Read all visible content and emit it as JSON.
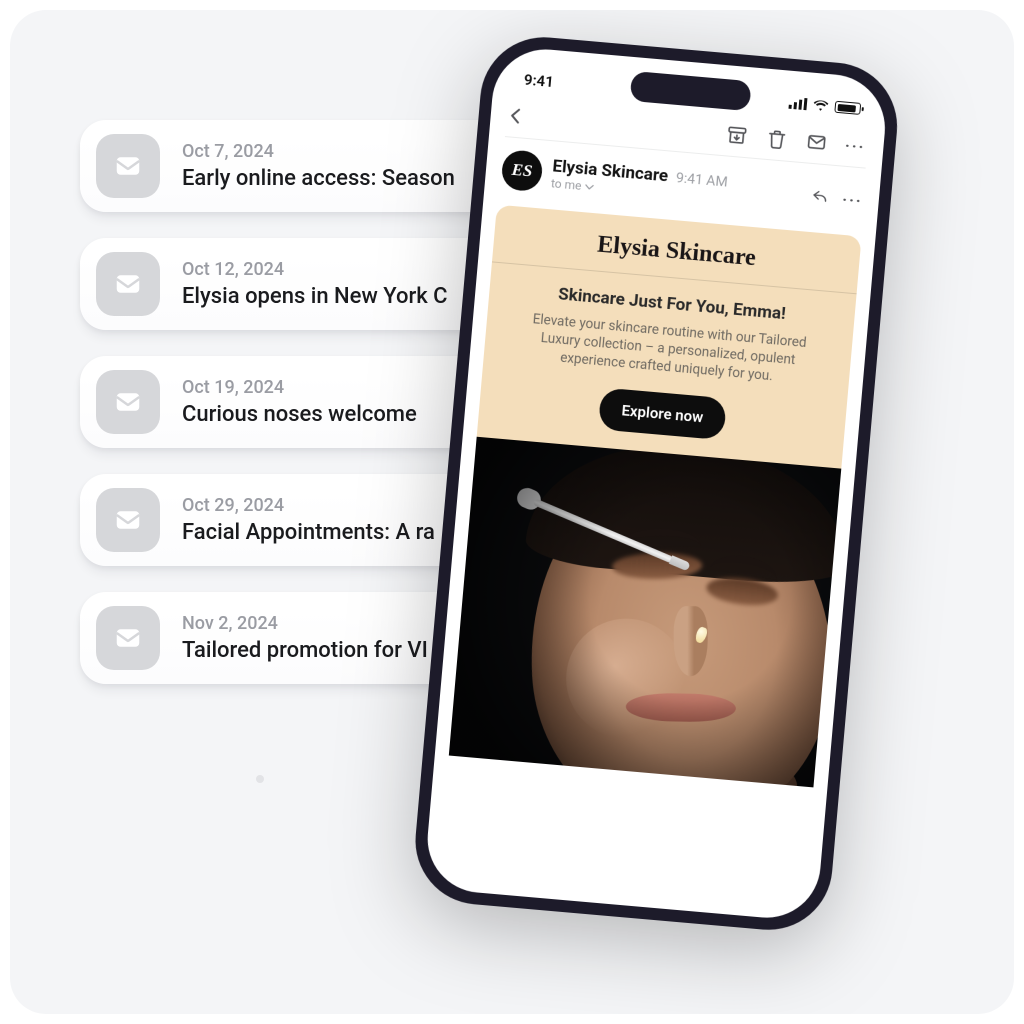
{
  "emails": [
    {
      "date": "Oct 7, 2024",
      "subject": "Early online access: Season"
    },
    {
      "date": "Oct 12, 2024",
      "subject": "Elysia opens in New York C"
    },
    {
      "date": "Oct 19, 2024",
      "subject": "Curious noses welcome"
    },
    {
      "date": "Oct 29, 2024",
      "subject": "Facial Appointments: A ra"
    },
    {
      "date": "Nov 2, 2024",
      "subject": "Tailored promotion for VI"
    }
  ],
  "phone": {
    "status_time": "9:41",
    "avatar_initials": "ES",
    "sender_name": "Elysia Skincare",
    "sender_time": "9:41 AM",
    "to_line": "to me",
    "brand": "Elysia Skincare",
    "hero_title": "Skincare Just For You, Emma!",
    "hero_body": "Elevate your skincare routine with our Tailored Luxury collection – a personalized, opulent experience crafted uniquely for you.",
    "cta": "Explore now"
  }
}
